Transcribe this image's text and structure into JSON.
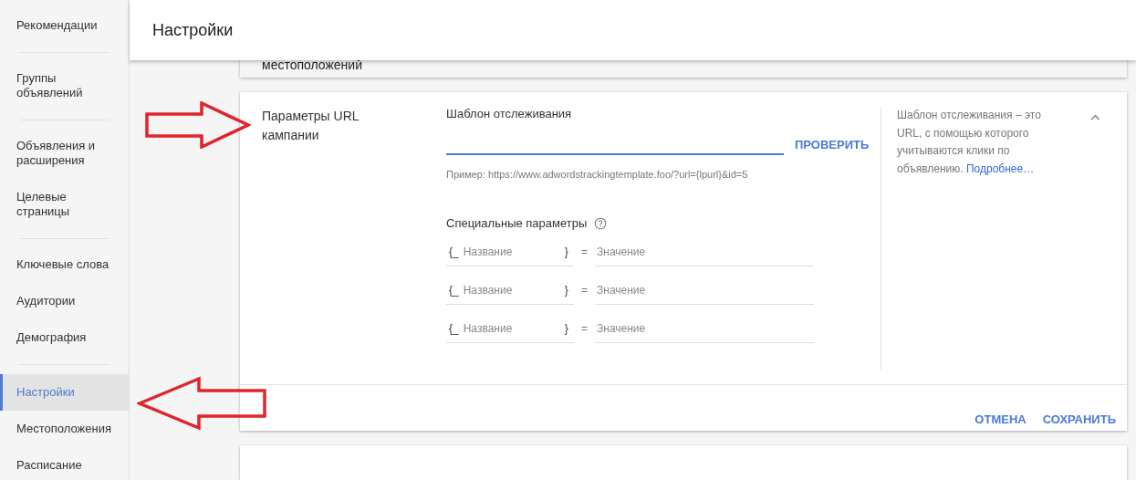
{
  "sidebar": {
    "groups": [
      [
        {
          "label": "Рекомендации",
          "selected": false
        }
      ],
      [
        {
          "label": "Группы объявлений",
          "selected": false
        }
      ],
      [
        {
          "label": "Объявления и расширения",
          "selected": false
        },
        {
          "label": "Целевые страницы",
          "selected": false
        }
      ],
      [
        {
          "label": "Ключевые слова",
          "selected": false
        },
        {
          "label": "Аудитории",
          "selected": false
        },
        {
          "label": "Демография",
          "selected": false
        }
      ],
      [
        {
          "label": "Настройки",
          "selected": true
        },
        {
          "label": "Местоположения",
          "selected": false
        },
        {
          "label": "Расписание",
          "selected": false
        }
      ]
    ]
  },
  "header": {
    "title": "Настройки"
  },
  "location_card": {
    "label": "местоположений"
  },
  "url_card": {
    "label": "Параметры URL кампании",
    "expanded": true,
    "tracking": {
      "label": "Шаблон отслеживания",
      "check_button": "ПРОВЕРИТЬ",
      "example": "Пример: https://www.adwordstrackingtemplate.foo/?url={lpurl}&id=5"
    },
    "custom_params": {
      "title": "Специальные параметры",
      "rows": [
        {
          "open": "{_",
          "name_placeholder": "Название",
          "close": "}",
          "equals": "=",
          "value_placeholder": "Значение"
        },
        {
          "open": "{_",
          "name_placeholder": "Название",
          "close": "}",
          "equals": "=",
          "value_placeholder": "Значение"
        },
        {
          "open": "{_",
          "name_placeholder": "Название",
          "close": "}",
          "equals": "=",
          "value_placeholder": "Значение"
        }
      ]
    },
    "help": {
      "text": "Шаблон отслеживания – это URL, с помощью которого учитываются клики по объявлению.",
      "link": "Подробнее…"
    },
    "buttons": [
      "ОТМЕНА",
      "СОХРАНИТЬ"
    ]
  }
}
